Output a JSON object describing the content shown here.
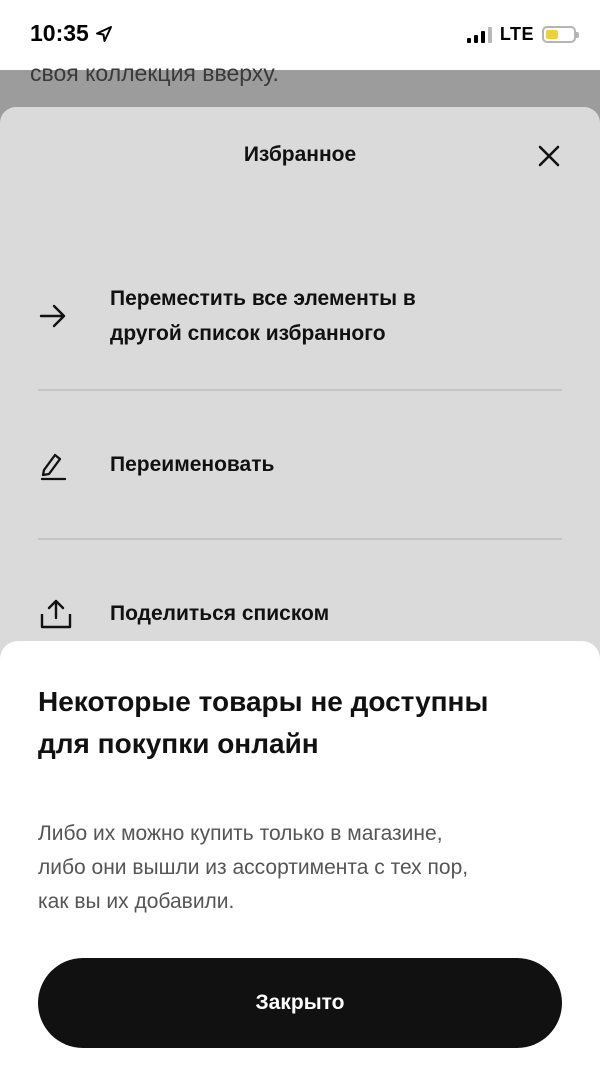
{
  "status_bar": {
    "time": "10:35",
    "network": "LTE"
  },
  "background": {
    "visible_text": "своя коллекция вверху."
  },
  "sheet": {
    "title": "Избранное",
    "items": [
      {
        "icon": "arrow-right-icon",
        "label_lines": [
          "Переместить все элементы в",
          "другой список избранного"
        ]
      },
      {
        "icon": "pencil-icon",
        "label": "Переименовать"
      },
      {
        "icon": "share-icon",
        "label": "Поделиться списком"
      }
    ]
  },
  "modal": {
    "heading_lines": [
      "Некоторые товары не доступны",
      "для покупки онлайн"
    ],
    "body_lines": [
      "Либо их можно купить только в магазине,",
      "либо они вышли из ассортимента с тех пор,",
      "как вы их добавили."
    ],
    "button_label": "Закрыто"
  },
  "colors": {
    "sheet_bg": "#dadada",
    "modal_bg": "#ffffff",
    "button_bg": "#111111",
    "battery_fill": "#f1cf3b"
  }
}
